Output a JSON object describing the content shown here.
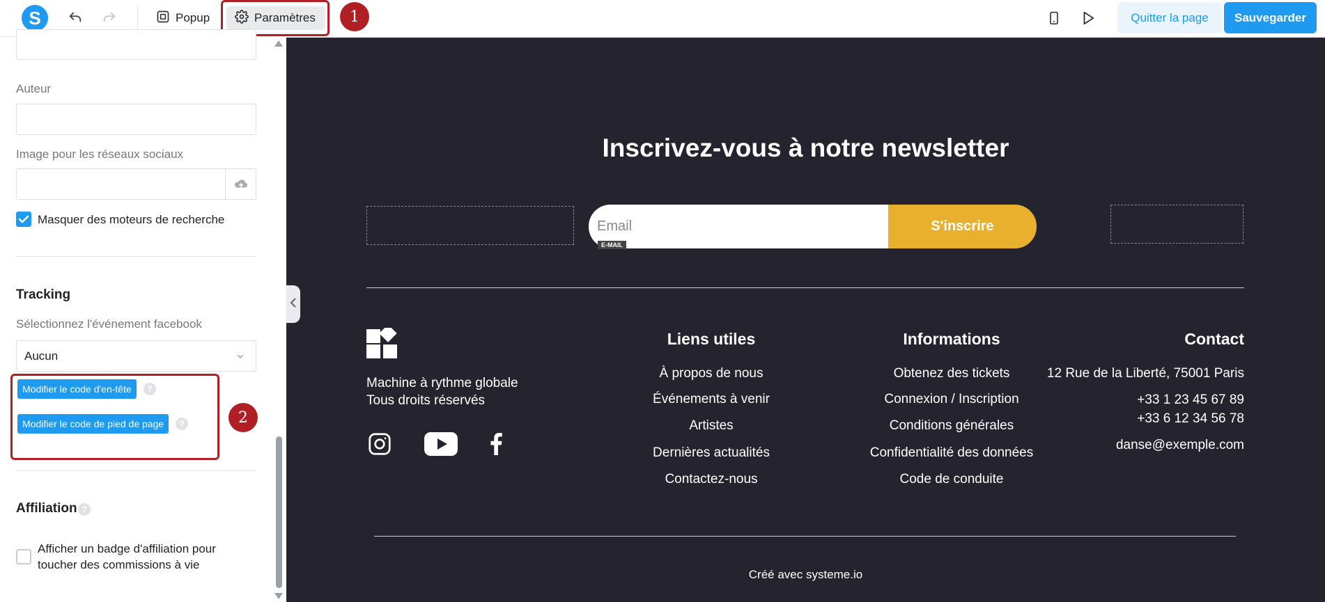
{
  "toolbar": {
    "logo": "S",
    "popup_label": "Popup",
    "settings_label": "Paramètres",
    "quit_label": "Quitter la page",
    "save_label": "Sauvegarder"
  },
  "annotations": {
    "marker1": "1",
    "marker2": "2"
  },
  "sidebar": {
    "author_label": "Auteur",
    "author_value": "",
    "social_image_label": "Image pour les réseaux sociaux",
    "hide_search_label": "Masquer des moteurs de recherche",
    "hide_search_checked": true,
    "tracking_title": "Tracking",
    "facebook_event_label": "Sélectionnez l'événement facebook",
    "facebook_event_value": "Aucun",
    "edit_header_code": "Modifier le code d'en-tête",
    "edit_footer_code": "Modifier le code de pied de page",
    "help_glyph": "?",
    "affiliation_title": "Affiliation",
    "affiliation_badge_label": "Afficher un badge d'affiliation pour toucher des commissions à vie",
    "affiliation_badge_checked": false
  },
  "page": {
    "newsletter_title": "Inscrivez-vous à notre newsletter",
    "email_placeholder": "Email",
    "email_tag": "E-MAIL",
    "subscribe_label": "S'inscrire",
    "brand_line1": "Machine à rythme globale",
    "brand_line2": "Tous droits réservés",
    "useful_links": {
      "title": "Liens utiles",
      "items": [
        "À propos de nous",
        "Événements à venir",
        "Artistes",
        "Dernières actualités",
        "Contactez-nous"
      ]
    },
    "informations": {
      "title": "Informations",
      "items": [
        "Obtenez des tickets",
        "Connexion / Inscription",
        "Conditions générales",
        "Confidentialité des données",
        "Code de conduite"
      ]
    },
    "contact": {
      "title": "Contact",
      "address": "12 Rue de la Liberté, 75001 Paris",
      "phone1": "+33 1 23 45 67 89",
      "phone2": "+33 6 12 34 56 78",
      "email": "danse@exemple.com"
    },
    "credit": "Créé avec systeme.io"
  },
  "colors": {
    "accent": "#1e9af0",
    "canvas_bg": "#25242e",
    "subscribe_btn": "#e8b02d",
    "annotation_red": "#b01f24"
  }
}
